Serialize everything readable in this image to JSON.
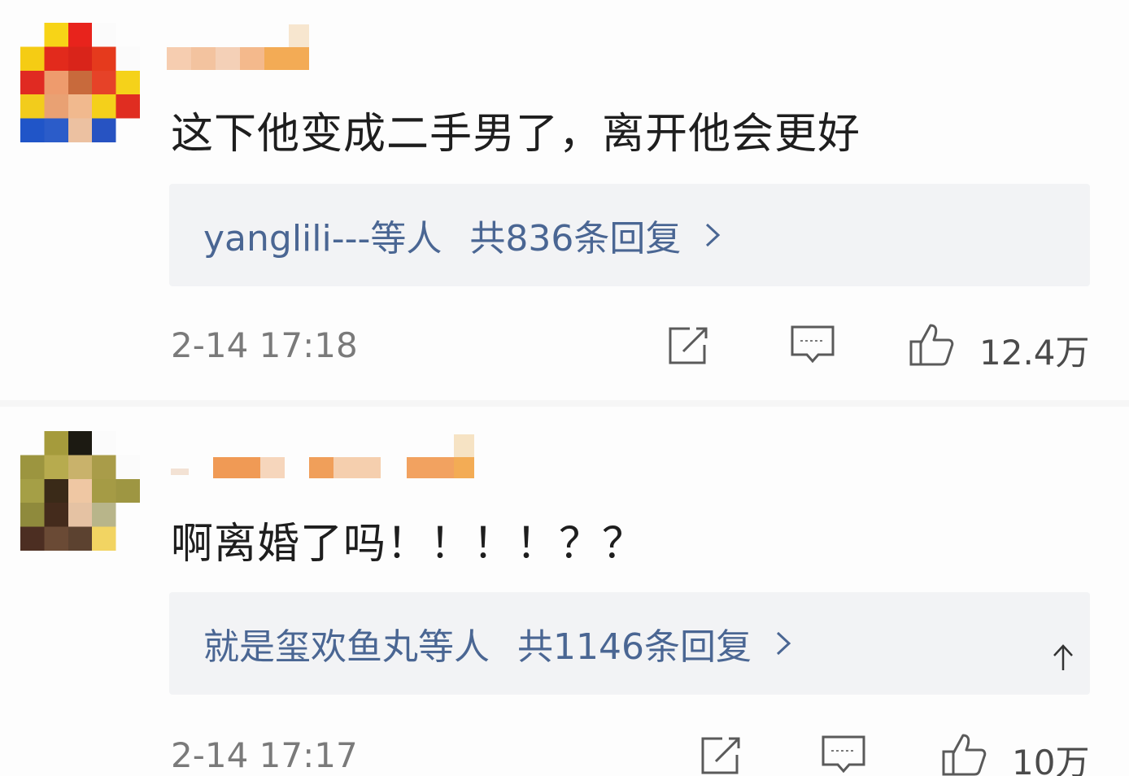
{
  "comments": [
    {
      "text": "这下他变成二手男了，离开他会更好",
      "reply_users": "yanglili---等人",
      "reply_total": "共836条回复",
      "timestamp": "2-14 17:18",
      "likes": "12.4万"
    },
    {
      "text": "啊离婚了吗！！！！？？",
      "reply_users": "就是玺欢鱼丸等人",
      "reply_total": "共1146条回复",
      "timestamp": "2-14 17:17",
      "likes": "10万"
    }
  ],
  "icons": {
    "share": "share-icon",
    "comment": "comment-icon",
    "like": "thumbs-up-icon",
    "chevron": "chevron-right-icon",
    "scroll_top": "arrow-up-icon"
  },
  "colors": {
    "reply_link": "#4a6693",
    "reply_bg": "#f2f3f5",
    "text": "#1e1e1e",
    "meta": "#7a7a7a"
  }
}
